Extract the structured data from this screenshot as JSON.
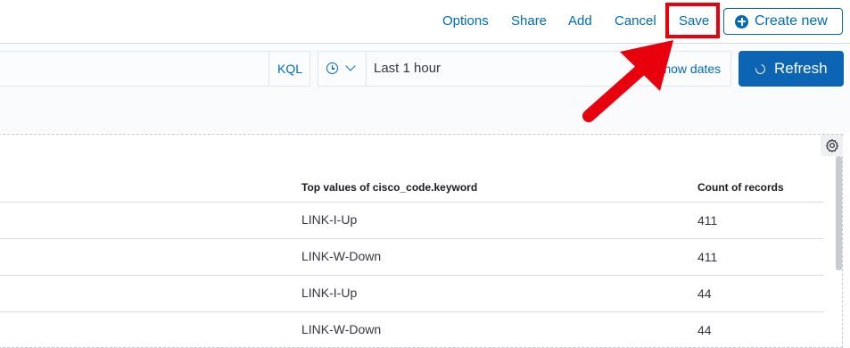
{
  "topnav": {
    "options": "Options",
    "share": "Share",
    "add": "Add",
    "cancel": "Cancel",
    "save": "Save",
    "create_new": "Create new"
  },
  "querybar": {
    "language": "KQL",
    "time_range": "Last 1 hour",
    "show_dates": "Show dates",
    "refresh": "Refresh"
  },
  "table": {
    "columns": [
      "Top values of cisco_code.keyword",
      "Count of records"
    ],
    "rows": [
      [
        "LINK-I-Up",
        "411"
      ],
      [
        "LINK-W-Down",
        "411"
      ],
      [
        "LINK-I-Up",
        "44"
      ],
      [
        "LINK-W-Down",
        "44"
      ]
    ]
  },
  "colors": {
    "accent": "#006bb8",
    "primary_button": "#0b64b4",
    "annotation": "#e8000d"
  }
}
